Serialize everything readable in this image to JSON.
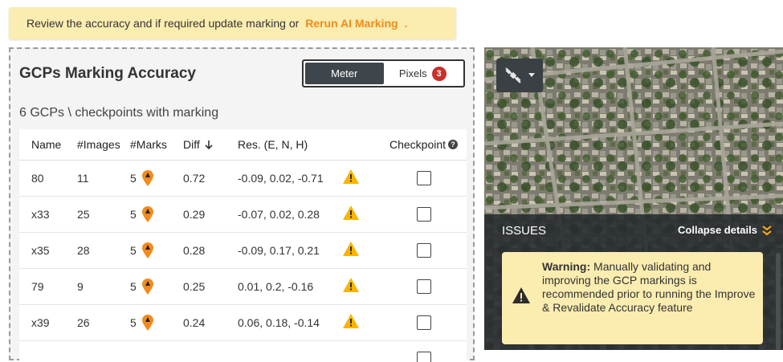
{
  "banner": {
    "text": "Review the accuracy and if required update marking or",
    "link": "Rerun AI Marking",
    "suffix": "."
  },
  "panel": {
    "title": "GCPs Marking Accuracy",
    "toggle": {
      "meter": "Meter",
      "pixels": "Pixels",
      "pixels_badge": "3"
    },
    "subtitle": "6 GCPs \\ checkpoints with marking",
    "columns": {
      "name": "Name",
      "images": "#Images",
      "marks": "#Marks",
      "diff": "Diff",
      "res": "Res. (E, N, H)",
      "checkpoint": "Checkpoint"
    },
    "rows": [
      {
        "name": "80",
        "images": "11",
        "marks": "5",
        "diff": "0.72",
        "res": "-0.09, 0.02, -0.71"
      },
      {
        "name": "x33",
        "images": "25",
        "marks": "5",
        "diff": "0.29",
        "res": "-0.07, 0.02, 0.28"
      },
      {
        "name": "x35",
        "images": "28",
        "marks": "5",
        "diff": "0.28",
        "res": "-0.09, 0.17, 0.21"
      },
      {
        "name": "79",
        "images": "9",
        "marks": "5",
        "diff": "0.25",
        "res": "0.01, 0.2, -0.16"
      },
      {
        "name": "x39",
        "images": "26",
        "marks": "5",
        "diff": "0.24",
        "res": "0.06, 0.18, -0.14"
      },
      {
        "name": "",
        "images": "",
        "marks": "",
        "diff": "",
        "res": ""
      }
    ]
  },
  "map": {
    "issues_title": "ISSUES",
    "collapse_label": "Collapse details",
    "warning_label": "Warning:",
    "warning_text": "Manually validating and improving the GCP markings is recommended prior to running the Improve & Revalidate Accuracy feature"
  },
  "colors": {
    "accent_orange": "#f08c1a",
    "warning_yellow": "#f7b500",
    "badge_red": "#c8302a",
    "banner_bg": "#fbecb0"
  }
}
